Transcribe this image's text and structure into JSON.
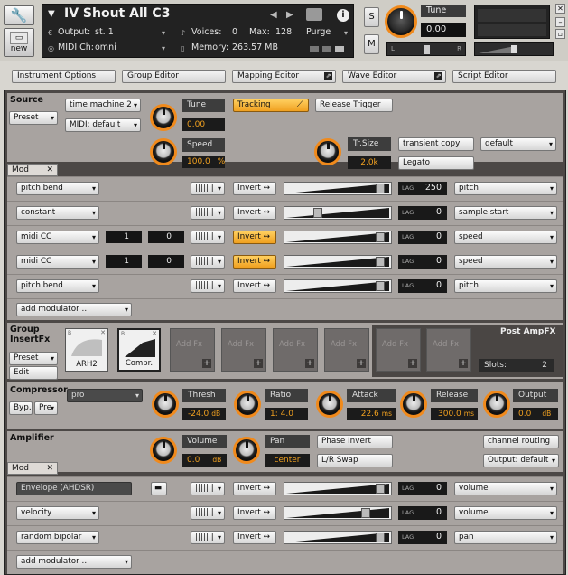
{
  "header": {
    "instrument_name": "IV Shout All C3",
    "output_label": "Output:",
    "output_value": "st. 1",
    "voices_label": "Voices:",
    "voices_value": "0",
    "max_label": "Max:",
    "max_value": "128",
    "purge_label": "Purge",
    "midi_label": "MIDI Ch:",
    "midi_value": "omni",
    "memory_label": "Memory:",
    "memory_value": "263.57 MB",
    "new_label": "new",
    "s_label": "S",
    "m_label": "M",
    "tune_label": "Tune",
    "tune_value": "0.00",
    "pan_l": "L",
    "pan_r": "R",
    "info_label": "i"
  },
  "tabs": [
    "Instrument Options",
    "Group Editor",
    "Mapping Editor",
    "Wave Editor",
    "Script Editor"
  ],
  "source": {
    "title": "Source",
    "preset": "Preset",
    "mode": "time machine 2",
    "midi": "MIDI: default",
    "tune_label": "Tune",
    "tune_value": "0.00",
    "tracking": "Tracking",
    "release_trigger": "Release Trigger",
    "speed_label": "Speed",
    "speed_value": "100.0",
    "speed_unit": "%",
    "trsize_label": "Tr.Size",
    "trsize_value": "2.0k",
    "transient_copy": "transient copy",
    "default_dd": "default",
    "legato": "Legato",
    "mod_tab": "Mod",
    "add_modulator": "add modulator ..."
  },
  "source_mods": [
    {
      "source": "pitch bend",
      "invert": "Invert",
      "lag": "250",
      "target": "pitch",
      "amount": 0.95
    },
    {
      "source": "constant",
      "invert": "Invert",
      "lag": "0",
      "target": "sample start",
      "amount": 0.3
    },
    {
      "source": "midi CC",
      "cc": "1",
      "def": "0",
      "invert": "Invert",
      "lag": "0",
      "target": "speed",
      "amount": 0.95,
      "invert_on": true
    },
    {
      "source": "midi CC",
      "cc": "1",
      "def": "0",
      "invert": "Invert",
      "lag": "0",
      "target": "speed",
      "amount": 0.95,
      "invert_on": true
    },
    {
      "source": "pitch bend",
      "invert": "Invert",
      "lag": "0",
      "target": "pitch",
      "amount": 0.95
    }
  ],
  "insertfx": {
    "title": "Group InsertFx",
    "preset": "Preset",
    "edit": "Edit",
    "slot1": "ARH2",
    "slot2": "Compr.",
    "add": "Add Fx",
    "post": "Post AmpFX",
    "slots_label": "Slots:",
    "slots_value": "2"
  },
  "compressor": {
    "title": "Compressor",
    "byp": "Byp.",
    "pre": "Pre",
    "mode": "pro",
    "threshold_label": "Thresh",
    "threshold_value": "-24.0",
    "threshold_unit": "dB",
    "ratio_label": "Ratio",
    "ratio_value": "1: 4.0",
    "attack_label": "Attack",
    "attack_value": "22.6",
    "attack_unit": "ms",
    "release_label": "Release",
    "release_value": "300.0",
    "release_unit": "ms",
    "output_label": "Output",
    "output_value": "0.0",
    "output_unit": "dB"
  },
  "amplifier": {
    "title": "Amplifier",
    "volume_label": "Volume",
    "volume_value": "0.0",
    "volume_unit": "dB",
    "pan_label": "Pan",
    "pan_value": "center",
    "phase_invert": "Phase Invert",
    "lr_swap": "L/R Swap",
    "channel_routing": "channel routing",
    "output": "Output: default",
    "mod_tab": "Mod",
    "add_modulator": "add modulator ..."
  },
  "amp_mods": [
    {
      "source": "Envelope (AHDSR)",
      "invert": "Invert",
      "lag": "0",
      "target": "volume",
      "amount": 0.95
    },
    {
      "source": "velocity",
      "invert": "Invert",
      "lag": "0",
      "target": "volume",
      "amount": 0.8
    },
    {
      "source": "random bipolar",
      "invert": "Invert",
      "lag": "0",
      "target": "pan",
      "amount": 0.95
    }
  ],
  "lag_label": "LAG",
  "colors": {
    "accent": "#f0a020",
    "knob_ring": "#f08a1c",
    "panel": "#a8a3a0"
  }
}
